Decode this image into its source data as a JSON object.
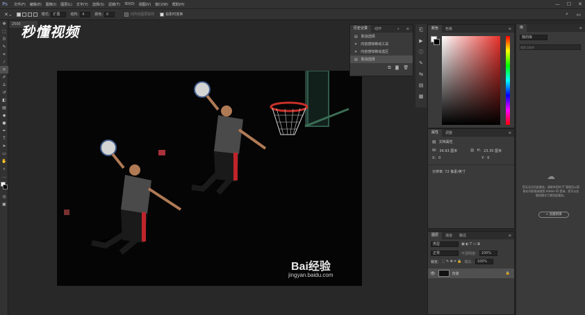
{
  "menu": {
    "logo": "Ps",
    "items": [
      "文件(F)",
      "编辑(E)",
      "图像(I)",
      "图层(L)",
      "文字(Y)",
      "选择(S)",
      "滤镜(T)",
      "3D(D)",
      "视图(V)",
      "窗口(W)",
      "帮助(H)"
    ]
  },
  "options": {
    "mode_label": "模式:",
    "mode_value": "扩展",
    "structure_label": "结构:",
    "structure_value": "4",
    "color_label": "颜色:",
    "color_value": "0",
    "sample_all_layers": "对所有图层取样",
    "transform_on_drop": "投影时变换"
  },
  "document": {
    "tab": "2500"
  },
  "watermark": {
    "title": "秒懂视频",
    "brand": "Bai经验",
    "url": "jingyan.baidu.com"
  },
  "history": {
    "tabs": [
      "历史记录",
      "动作"
    ],
    "items": [
      "取消选择",
      "内容感知移动工具",
      "内容感知移动选区",
      "取消选择"
    ]
  },
  "color": {
    "tabs": [
      "颜色",
      "色板"
    ],
    "accent": "#e8322c"
  },
  "properties": {
    "tabs": [
      "属性",
      "调整"
    ],
    "title": "文档属性",
    "w_label": "W:",
    "w_value": "34.93 厘米",
    "h_label": "H:",
    "h_value": "23.35 厘米",
    "x_label": "X:",
    "x_value": "0",
    "y_label": "Y:",
    "y_value": "0",
    "resolution": "分辨率: 72 像素/英寸"
  },
  "layers": {
    "tabs": [
      "图层",
      "通道",
      "路径"
    ],
    "kind_label": "类型",
    "blend_label": "正常",
    "opacity_label": "不透明度:",
    "opacity_value": "100%",
    "lock_label": "锁定:",
    "fill_label": "填充:",
    "fill_value": "100%",
    "layer_name": "背景"
  },
  "library": {
    "tab": "库",
    "dropdown": "我的库",
    "search_placeholder": "搜索当前库",
    "message": "您无法访问此服务。请联系您的 IT 管理员以获取访问权限或使用 Adobe ID 登录，您可以在脱机模式下使用此服务。",
    "create_button": "+ 创建新库"
  }
}
